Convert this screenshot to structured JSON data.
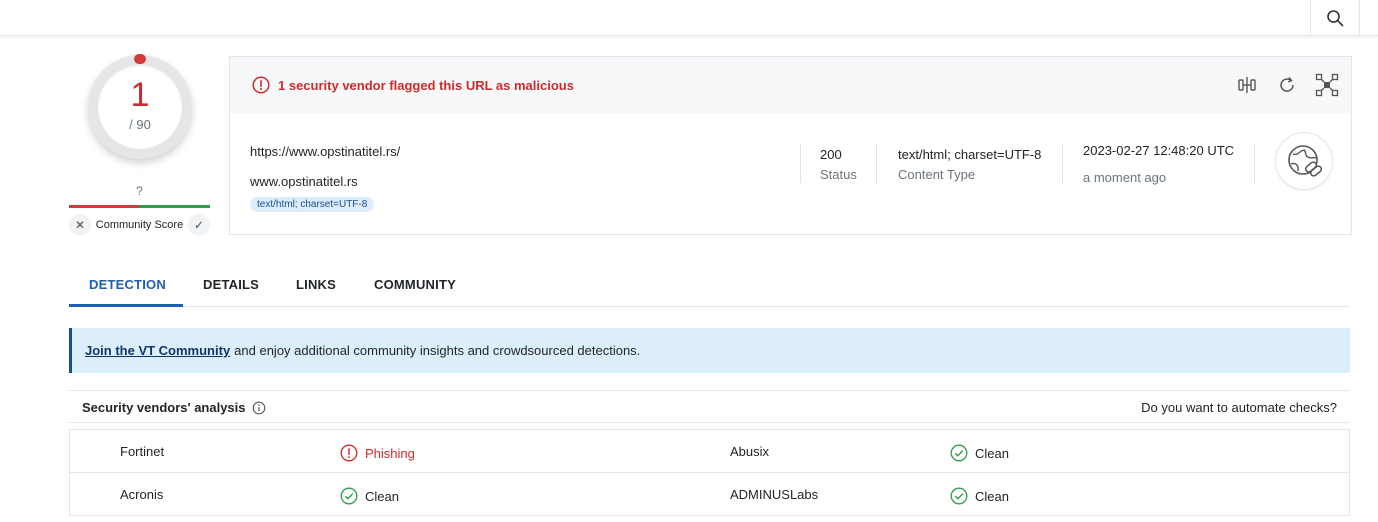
{
  "score": {
    "value": "1",
    "total": "/ 90"
  },
  "community": {
    "question": "?",
    "label": "Community Score",
    "dislike_symbol": "✕",
    "like_symbol": "✓"
  },
  "summary": {
    "alert": "1 security vendor flagged this URL as malicious",
    "url": "https://www.opstinatitel.rs/",
    "host": "www.opstinatitel.rs",
    "tag": "text/html; charset=UTF-8",
    "status_value": "200",
    "status_label": "Status",
    "content_type_value": "text/html; charset=UTF-8",
    "content_type_label": "Content Type",
    "date_value": "2023-02-27 12:48:20 UTC",
    "date_relative": "a moment ago"
  },
  "tabs": [
    {
      "label": "DETECTION",
      "active": true
    },
    {
      "label": "DETAILS",
      "active": false
    },
    {
      "label": "LINKS",
      "active": false
    },
    {
      "label": "COMMUNITY",
      "active": false
    }
  ],
  "banner": {
    "link": "Join the VT Community",
    "text": "and enjoy additional community insights and crowdsourced detections."
  },
  "vendors": {
    "title": "Security vendors' analysis",
    "automate": "Do you want to automate checks?",
    "rows": [
      {
        "left_vendor": "Fortinet",
        "left_result": "Phishing",
        "left_status": "malicious",
        "right_vendor": "Abusix",
        "right_result": "Clean",
        "right_status": "clean"
      },
      {
        "left_vendor": "Acronis",
        "left_result": "Clean",
        "left_status": "clean",
        "right_vendor": "ADMINUSLabs",
        "right_result": "Clean",
        "right_status": "clean"
      }
    ]
  },
  "colors": {
    "malicious": "#cc2b2b",
    "clean": "#2e9e4a",
    "accent": "#1f5fb7"
  }
}
